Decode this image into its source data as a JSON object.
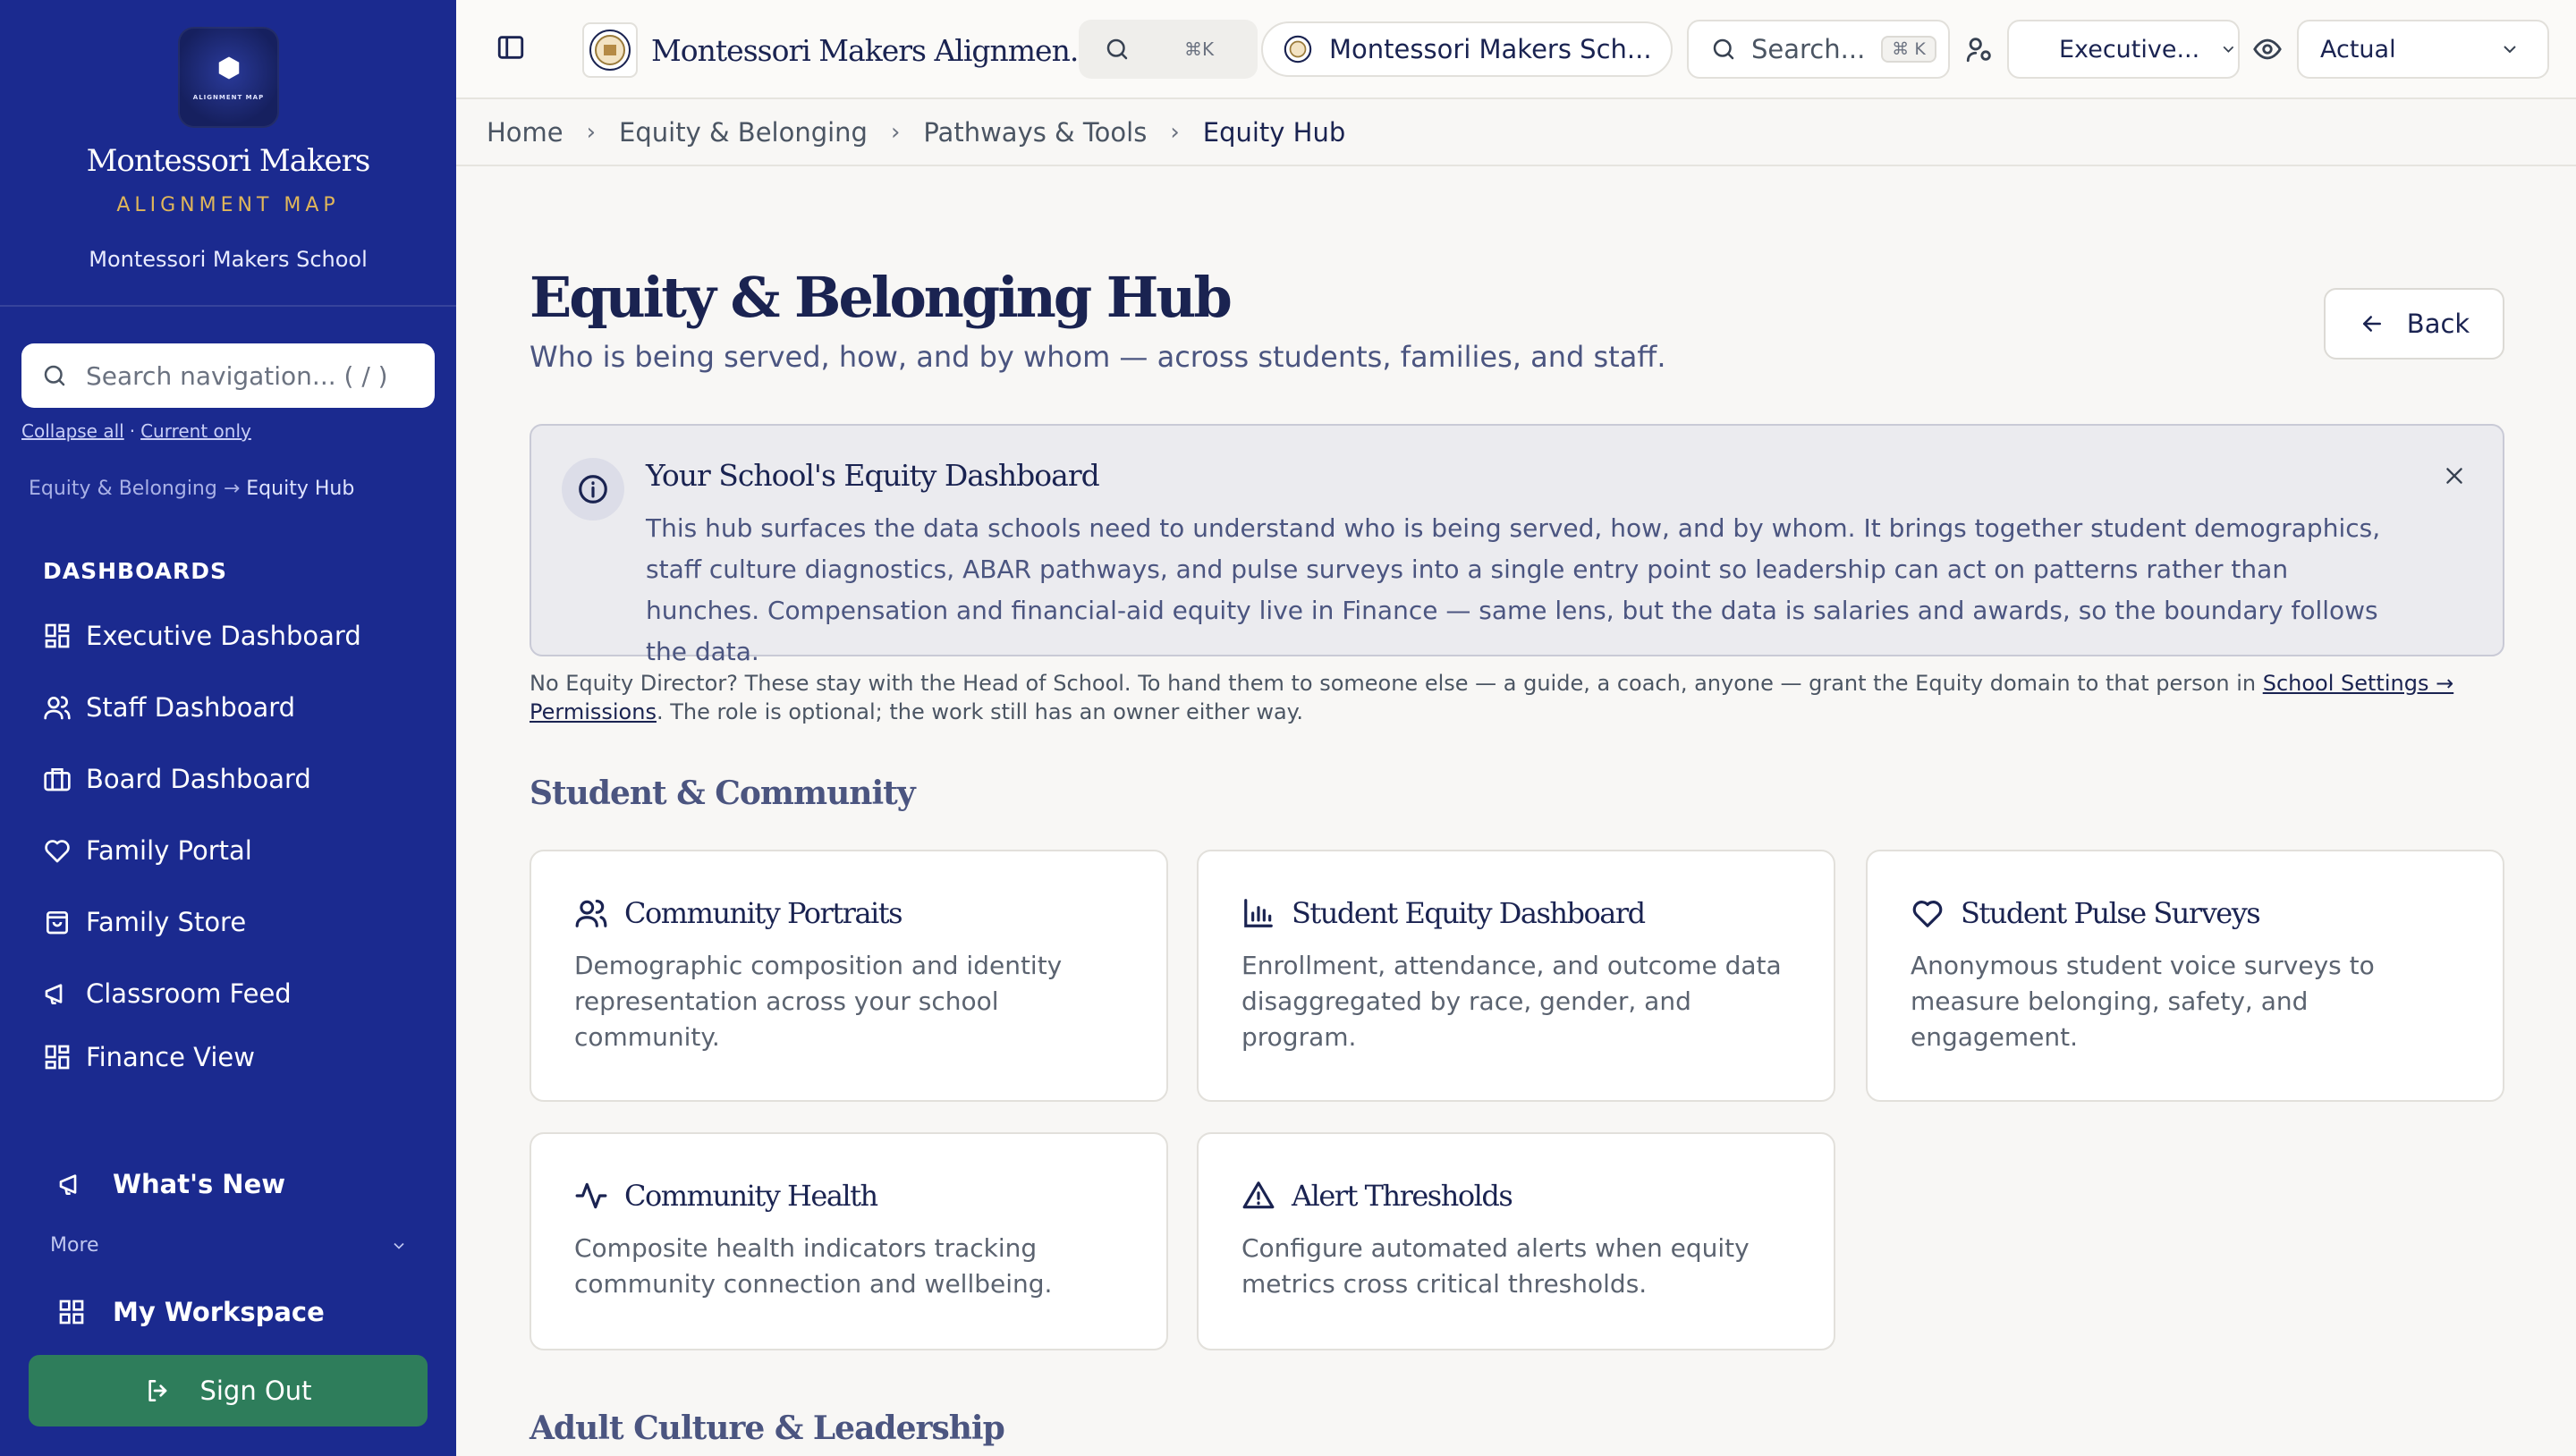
{
  "sidebar": {
    "logo_text": "ALIGNMENT MAP",
    "brand_name": "Montessori Makers",
    "brand_sub": "ALIGNMENT MAP",
    "school": "Montessori Makers School",
    "search_placeholder": "Search navigation... ( / )",
    "collapse_all": "Collapse all",
    "current_only": "Current only",
    "crumb_parent": "Equity & Belonging",
    "crumb_arrow": "→",
    "crumb_current": "Equity Hub",
    "section_label": "DASHBOARDS",
    "items": [
      {
        "label": "Executive Dashboard",
        "icon": "grid-icon"
      },
      {
        "label": "Staff Dashboard",
        "icon": "users-icon"
      },
      {
        "label": "Board Dashboard",
        "icon": "briefcase-icon"
      },
      {
        "label": "Family Portal",
        "icon": "heart-icon"
      },
      {
        "label": "Family Store",
        "icon": "store-icon"
      },
      {
        "label": "Classroom Feed",
        "icon": "megaphone-icon"
      },
      {
        "label": "Finance View",
        "icon": "grid-icon"
      }
    ],
    "whats_new": "What's New",
    "more": "More",
    "my_workspace": "My Workspace",
    "sign_out": "Sign Out"
  },
  "topbar": {
    "app_title": "Montessori Makers Alignmen...",
    "quick_shortcut": "⌘K",
    "school_selector": "Montessori Makers Sch...",
    "search_placeholder": "Search...",
    "search_shortcut": "⌘ K",
    "role_select": "Executive...",
    "view_select": "Actual"
  },
  "breadcrumb": [
    "Home",
    "Equity & Belonging",
    "Pathways & Tools",
    "Equity Hub"
  ],
  "page": {
    "title": "Equity & Belonging Hub",
    "subtitle": "Who is being served, how, and by whom — across students, families, and staff.",
    "back_label": "Back"
  },
  "info": {
    "title": "Your School's Equity Dashboard",
    "body": "This hub surfaces the data schools need to understand who is being served, how, and by whom. It brings together student demographics, staff culture diagnostics, ABAR pathways, and pulse surveys into a single entry point so leadership can act on patterns rather than hunches. Compensation and financial-aid equity live in Finance — same lens, but the data is salaries and awards, so the boundary follows the data."
  },
  "note": {
    "text": "No Equity Director? These stay with the Head of School. To hand them to someone else — a guide, a coach, anyone — grant the Equity domain to that person in ",
    "link": "School Settings → Permissions",
    "tail": ". The role is optional; the work still has an owner either way."
  },
  "sections": {
    "student_community": "Student & Community",
    "adult_culture": "Adult Culture & Leadership"
  },
  "cards": [
    {
      "title": "Community Portraits",
      "desc": "Demographic composition and identity representation across your school community.",
      "icon": "users-icon"
    },
    {
      "title": "Student Equity Dashboard",
      "desc": "Enrollment, attendance, and outcome data disaggregated by race, gender, and program.",
      "icon": "bar-chart-icon"
    },
    {
      "title": "Student Pulse Surveys",
      "desc": "Anonymous student voice surveys to measure belonging, safety, and engagement.",
      "icon": "heart-icon"
    },
    {
      "title": "Community Health",
      "desc": "Composite health indicators tracking community connection and wellbeing.",
      "icon": "activity-icon"
    },
    {
      "title": "Alert Thresholds",
      "desc": "Configure automated alerts when equity metrics cross critical thresholds.",
      "icon": "alert-triangle-icon"
    }
  ],
  "colors": {
    "sidebar_bg": "#1b2a8f",
    "accent_gold": "#e0b65a",
    "signout_green": "#2e7d5b",
    "navy_text": "#1a2351"
  }
}
